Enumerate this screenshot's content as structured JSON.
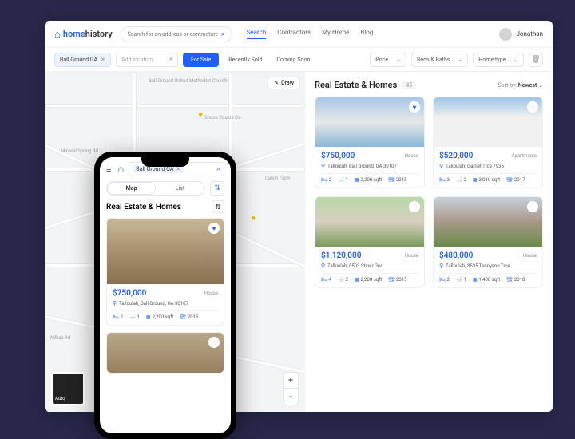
{
  "brand": {
    "name1": "home",
    "name2": "history"
  },
  "search": {
    "placeholder": "Search for an address or contractors"
  },
  "nav": {
    "search": "Search",
    "contractors": "Contractors",
    "myhome": "My Home",
    "blog": "Blog"
  },
  "user": {
    "name": "Jonathan"
  },
  "filters": {
    "location_tag": "Ball Ground GA",
    "add_location": "Add location",
    "for_sale": "For Sale",
    "recently_sold": "Recently Sold",
    "coming_soon": "Coming Soon",
    "price": "Price",
    "beds_baths": "Beds & Baths",
    "home_type": "Home type"
  },
  "map": {
    "draw": "Draw",
    "mini": "Auto",
    "labels": {
      "church": "Ball Ground United Methodist Church",
      "cookie": "Shook Cookie Co",
      "spring": "Mineral Spring Rd",
      "wilkes": "Wilkes Rd",
      "calvin": "Calvin Farm"
    }
  },
  "listings": {
    "title": "Real Estate & Homes",
    "count": "45",
    "sort_label": "Sort by:",
    "sort_value": "Newest"
  },
  "cards": [
    {
      "price": "$750,000",
      "type": "House",
      "addr": "Talloulah, Ball Ground, GA 30107",
      "beds": "2",
      "baths": "1",
      "sqft": "2,200 sqft",
      "year": "2015",
      "fav": true,
      "img": "modern"
    },
    {
      "price": "$520,000",
      "type": "Apartments",
      "addr": "Talloulah, Garnet Trce 7935",
      "beds": "3",
      "baths": "2",
      "sqft": "3,010 sqft",
      "year": "2017",
      "fav": false,
      "img": "white"
    },
    {
      "price": "$1,120,000",
      "type": "House",
      "addr": "Talloulah, 8503 Stiner Grv",
      "beds": "4",
      "baths": "2",
      "sqft": "2,200 sqft",
      "year": "2015",
      "fav": false,
      "img": "green"
    },
    {
      "price": "$480,000",
      "type": "House",
      "addr": "Talloulah, 8535 Tennyson Trce",
      "beds": "2",
      "baths": "1",
      "sqft": "1,400 sqft",
      "year": "2018",
      "fav": false,
      "img": "stone"
    }
  ],
  "phone": {
    "location_tag": "Ball Ground GA",
    "tab_map": "Map",
    "tab_list": "List",
    "title": "Real Estate & Homes",
    "card": {
      "price": "$750,000",
      "type": "House",
      "addr": "Talloulah, Ball Ground, GA 30107",
      "beds": "2",
      "baths": "1",
      "sqft": "2,200 sqft",
      "year": "2015"
    }
  }
}
